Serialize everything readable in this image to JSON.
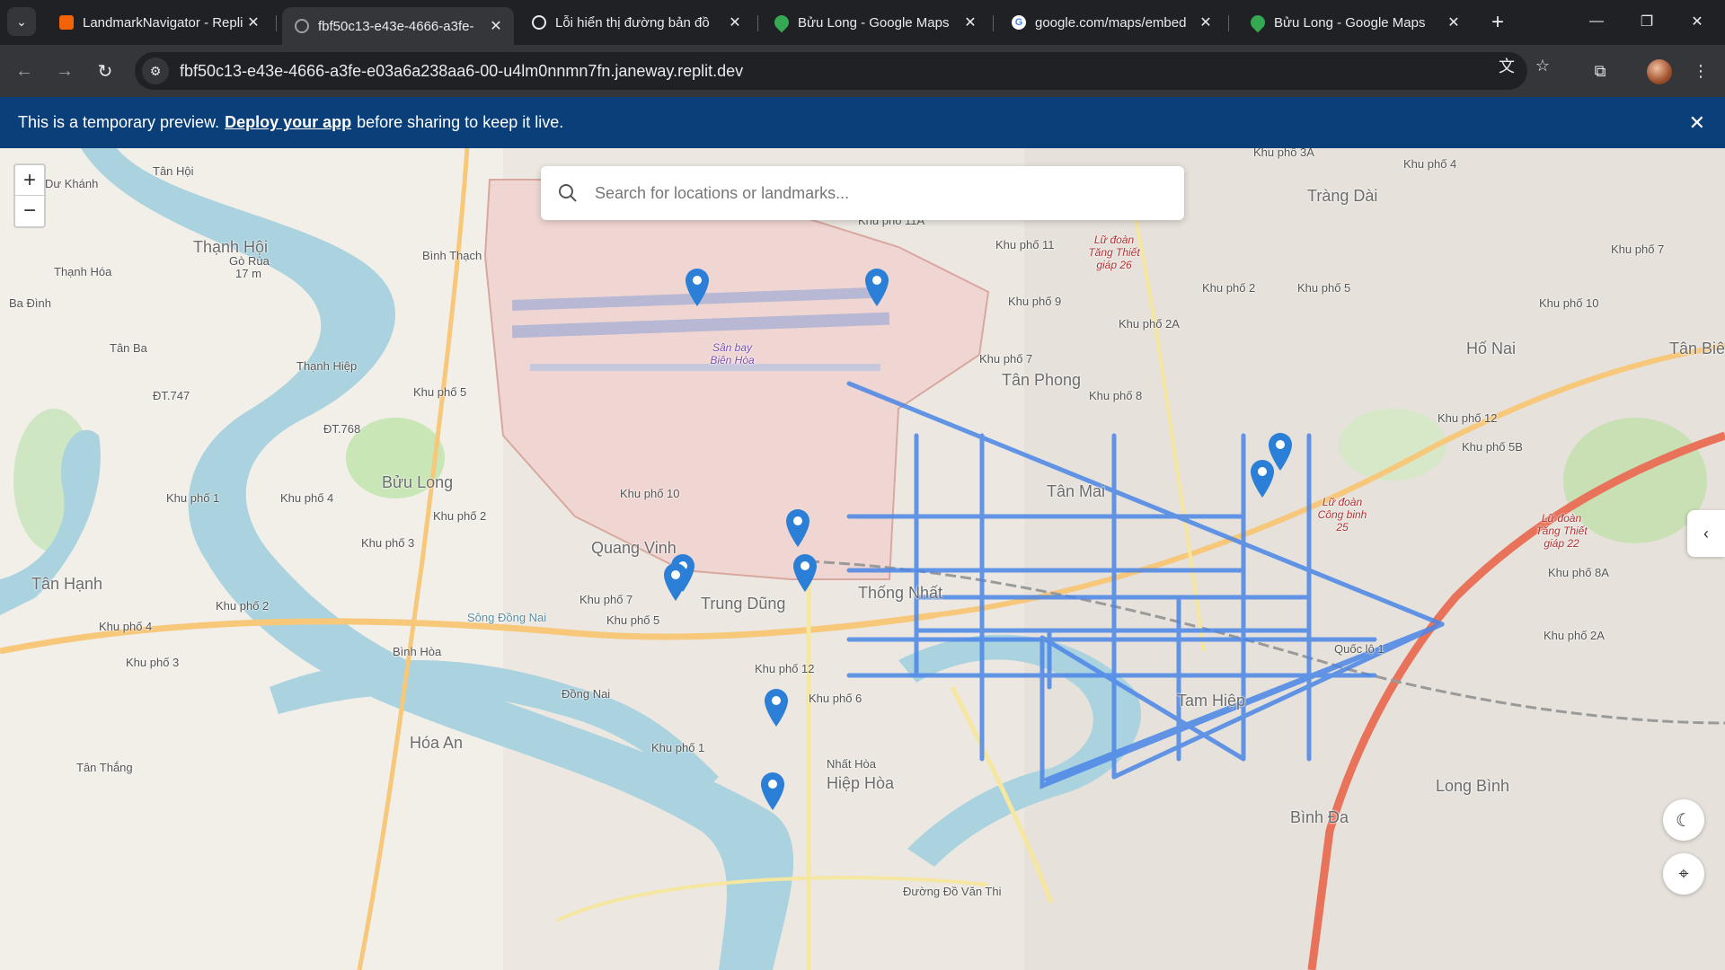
{
  "browser": {
    "tab_menu_icon": "chevron-down",
    "tabs": [
      {
        "title": "LandmarkNavigator - Repli",
        "favicon": "replit",
        "active": false
      },
      {
        "title": "fbf50c13-e43e-4666-a3fe-",
        "favicon": "globe",
        "active": true
      },
      {
        "title": "Lỗi hiển thị đường bản đồ",
        "favicon": "openai",
        "active": false
      },
      {
        "title": "Bửu Long - Google Maps",
        "favicon": "google-maps",
        "active": false
      },
      {
        "title": "google.com/maps/embed",
        "favicon": "google",
        "active": false
      },
      {
        "title": "Bửu Long - Google Maps",
        "favicon": "google-maps",
        "active": false
      }
    ],
    "url": "fbf50c13-e43e-4666-a3fe-e03a6a238aa6-00-u4lm0nnmn7fn.janeway.replit.dev"
  },
  "banner": {
    "text_before": "This is a temporary preview.",
    "link": "Deploy your app",
    "text_after": "before sharing to keep it live."
  },
  "search": {
    "placeholder": "Search for locations or landmarks..."
  },
  "map": {
    "labels": [
      {
        "text": "Tân Hội",
        "cls": ""
      },
      {
        "text": "Dư Khánh",
        "cls": ""
      },
      {
        "text": "Thạnh Hội",
        "cls": "big"
      },
      {
        "text": "Gò Rùa",
        "cls": ""
      },
      {
        "text": "17 m",
        "cls": ""
      },
      {
        "text": "Thạnh Hóa",
        "cls": ""
      },
      {
        "text": "Ba Đình",
        "cls": ""
      },
      {
        "text": "Tân Ba",
        "cls": ""
      },
      {
        "text": "Thạnh Hiệp",
        "cls": ""
      },
      {
        "text": "ĐT.747",
        "cls": ""
      },
      {
        "text": "ĐT.768",
        "cls": ""
      },
      {
        "text": "Khu phố 5",
        "cls": ""
      },
      {
        "text": "Bình Thạch",
        "cls": ""
      },
      {
        "text": "Bửu Long",
        "cls": "big"
      },
      {
        "text": "Khu phố 1",
        "cls": ""
      },
      {
        "text": "Khu phố 4",
        "cls": ""
      },
      {
        "text": "Khu phố 2",
        "cls": ""
      },
      {
        "text": "Khu phố 3",
        "cls": ""
      },
      {
        "text": "Khu phố 10",
        "cls": ""
      },
      {
        "text": "Tân Hạnh",
        "cls": "big"
      },
      {
        "text": "Khu phố 2",
        "cls": ""
      },
      {
        "text": "Khu phố 4",
        "cls": ""
      },
      {
        "text": "Khu phố 3",
        "cls": ""
      },
      {
        "text": "Bình Hòa",
        "cls": ""
      },
      {
        "text": "Đồng Nai",
        "cls": ""
      },
      {
        "text": "Hóa An",
        "cls": "big"
      },
      {
        "text": "Tân Thắng",
        "cls": ""
      },
      {
        "text": "Quang Vinh",
        "cls": "big"
      },
      {
        "text": "Trung Dũng",
        "cls": "big"
      },
      {
        "text": "Thống Nhất",
        "cls": "big"
      },
      {
        "text": "Khu phố 7",
        "cls": ""
      },
      {
        "text": "Khu phố 5",
        "cls": ""
      },
      {
        "text": "Khu phố 12",
        "cls": ""
      },
      {
        "text": "Khu phố 6",
        "cls": ""
      },
      {
        "text": "Khu phố 1",
        "cls": ""
      },
      {
        "text": "Nhất Hòa",
        "cls": ""
      },
      {
        "text": "Hiệp Hòa",
        "cls": "big"
      },
      {
        "text": "Sân bay Biên Hòa",
        "cls": "airport"
      },
      {
        "text": "Khu phố 11A",
        "cls": ""
      },
      {
        "text": "Khu phố 11",
        "cls": ""
      },
      {
        "text": "Khu phố 9",
        "cls": ""
      },
      {
        "text": "Khu phố 7",
        "cls": ""
      },
      {
        "text": "Tân Phong",
        "cls": "big"
      },
      {
        "text": "Khu phố 8",
        "cls": ""
      },
      {
        "text": "Khu phố 2A",
        "cls": ""
      },
      {
        "text": "Khu phố 2",
        "cls": ""
      },
      {
        "text": "Khu phố 5",
        "cls": ""
      },
      {
        "text": "Tân Mai",
        "cls": "big"
      },
      {
        "text": "Tam Hiệp",
        "cls": "big"
      },
      {
        "text": "Bình Đa",
        "cls": "big"
      },
      {
        "text": "Tràng Dài",
        "cls": "big"
      },
      {
        "text": "Hố Nai",
        "cls": "big"
      },
      {
        "text": "Long Bình",
        "cls": "big"
      },
      {
        "text": "Tân Biên",
        "cls": "big"
      },
      {
        "text": "Khu phố 3A",
        "cls": ""
      },
      {
        "text": "Khu phố 4",
        "cls": ""
      },
      {
        "text": "Khu phố 7",
        "cls": ""
      },
      {
        "text": "Khu phố 10",
        "cls": ""
      },
      {
        "text": "Khu phố 12",
        "cls": ""
      },
      {
        "text": "Khu phố 5B",
        "cls": ""
      },
      {
        "text": "Khu phố 8A",
        "cls": ""
      },
      {
        "text": "Khu phố 2A",
        "cls": ""
      },
      {
        "text": "Lữ đoàn Tăng Thiết giáp 26",
        "cls": "red"
      },
      {
        "text": "Lữ đoàn Công binh 25",
        "cls": "red"
      },
      {
        "text": "Lữ đoàn Tăng Thiết giáp 22",
        "cls": "red"
      },
      {
        "text": "Sông Đồng Nai",
        "cls": ""
      },
      {
        "text": "Quốc lộ 1",
        "cls": ""
      },
      {
        "text": "Đường Đồ Văn Thi",
        "cls": ""
      }
    ]
  },
  "controls": {
    "zoom_in": "+",
    "zoom_out": "−",
    "side_toggle": "‹",
    "theme_icon": "☾",
    "locate_icon": "⌖"
  },
  "colors": {
    "route": "#4a86e8",
    "pin": "#2b7fd6",
    "banner": "#0b3f7a",
    "river": "#aad3df"
  }
}
